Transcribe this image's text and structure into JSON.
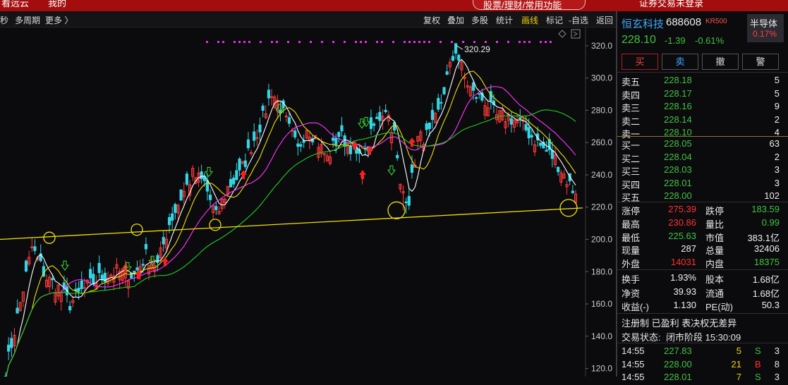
{
  "topbar": {
    "left1": "看远云",
    "left2": "我的",
    "search": "股票/理财/常用功能",
    "right": "证券交易未登录"
  },
  "toolbar": {
    "left": [
      "秒",
      "多周期",
      "更多 〉"
    ],
    "right": [
      "复权",
      "叠加",
      "多股",
      "统计",
      "画线",
      "标记",
      "-自选",
      "返回"
    ],
    "active": "画线"
  },
  "stock": {
    "name": "恒玄科技",
    "code": "688608",
    "kr": "KR500",
    "price": "228.10",
    "change": "-1.39",
    "pct": "-0.61%",
    "sector": "半导体",
    "sector_pct": "0.17%"
  },
  "buttons": {
    "buy": "买",
    "sell": "卖",
    "cancel": "撤",
    "alert": "警"
  },
  "asks": [
    {
      "label": "卖五",
      "price": "228.18",
      "vol": "5"
    },
    {
      "label": "卖四",
      "price": "228.17",
      "vol": "5"
    },
    {
      "label": "卖三",
      "price": "228.16",
      "vol": "9"
    },
    {
      "label": "卖二",
      "price": "228.14",
      "vol": "2"
    },
    {
      "label": "卖一",
      "price": "228.10",
      "vol": "4"
    }
  ],
  "bids": [
    {
      "label": "买一",
      "price": "228.05",
      "vol": "63"
    },
    {
      "label": "买二",
      "price": "228.04",
      "vol": "2"
    },
    {
      "label": "买三",
      "price": "228.03",
      "vol": "3"
    },
    {
      "label": "买四",
      "price": "228.01",
      "vol": "3"
    },
    {
      "label": "买五",
      "price": "228.00",
      "vol": "102"
    }
  ],
  "stats": [
    {
      "l1": "涨停",
      "v1": "275.39",
      "c1": "red",
      "l2": "跌停",
      "v2": "183.59",
      "c2": "grn"
    },
    {
      "l1": "最高",
      "v1": "230.86",
      "c1": "red",
      "l2": "量比",
      "v2": "0.99",
      "c2": "grn"
    },
    {
      "l1": "最低",
      "v1": "225.63",
      "c1": "grn",
      "l2": "市值",
      "v2": "383.1亿",
      "c2": "wht"
    },
    {
      "l1": "现量",
      "v1": "287",
      "c1": "wht",
      "l2": "总量",
      "v2": "32406",
      "c2": "wht"
    },
    {
      "l1": "外盘",
      "v1": "14031",
      "c1": "red",
      "l2": "内盘",
      "v2": "18375",
      "c2": "grn"
    }
  ],
  "stats2": [
    {
      "l1": "换手",
      "v1": "1.93%",
      "l2": "股本",
      "v2": "1.68亿"
    },
    {
      "l1": "净资",
      "v1": "39.93",
      "l2": "流通",
      "v2": "1.68亿"
    },
    {
      "l1": "收益(-)",
      "v1": "1.130",
      "l2": "PE(动)",
      "v2": "50.3"
    }
  ],
  "info": {
    "line1": "注册制 已盈利 表决权无差异",
    "status_label": "交易状态:",
    "status_value": "闭市阶段 15:30:09"
  },
  "ticks": [
    {
      "time": "14:55",
      "price": "227.83",
      "vol": "5",
      "side": "S",
      "n": "3"
    },
    {
      "time": "14:55",
      "price": "228.00",
      "vol": "21",
      "side": "B",
      "n": "8"
    },
    {
      "time": "14:55",
      "price": "228.01",
      "vol": "7",
      "side": "S",
      "n": "3"
    }
  ],
  "chart_data": {
    "type": "candlestick",
    "y_ticks": [
      "320.0",
      "300.0",
      "280.0",
      "260.0",
      "240.0",
      "220.0",
      "200.0",
      "180.0",
      "160.0",
      "140.0",
      "120.0"
    ],
    "ylim": [
      115,
      330
    ],
    "max_label": "320.29",
    "colors": {
      "up": "#ff3b3b",
      "down": "#33d6e6",
      "ma5": "#ffffff",
      "ma10": "#f0e000",
      "ma20": "#ff33ff",
      "ma60": "#22cc22",
      "trend": "#f0e000"
    },
    "trendline": {
      "from": 200.0,
      "to": 219.5
    }
  }
}
